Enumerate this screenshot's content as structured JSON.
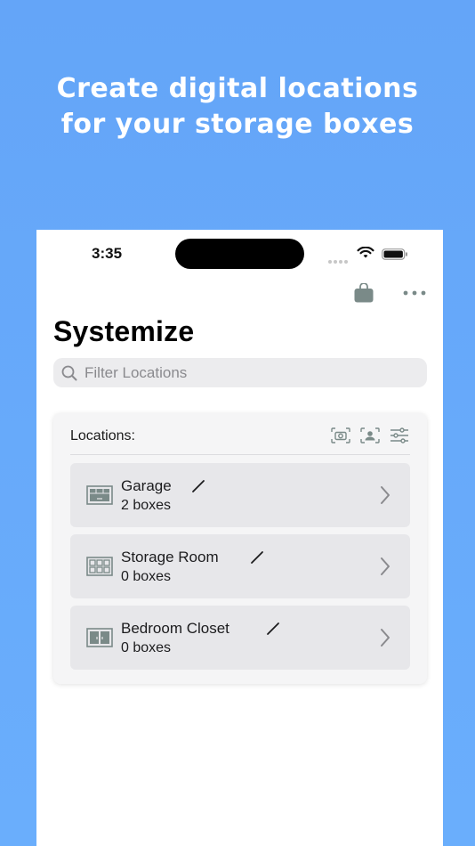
{
  "promo": {
    "line1": "Create digital locations",
    "line2": "for your storage boxes"
  },
  "status_bar": {
    "time": "3:35"
  },
  "app": {
    "title": "Systemize"
  },
  "search": {
    "placeholder": "Filter Locations",
    "value": ""
  },
  "locations_card": {
    "title": "Locations:",
    "tool_icons": [
      "camera-icon",
      "person-scan-icon",
      "sliders-icon"
    ],
    "items": [
      {
        "name": "Garage",
        "count": "2 boxes",
        "icon": "garage-icon"
      },
      {
        "name": "Storage Room",
        "count": "0 boxes",
        "icon": "shelves-icon"
      },
      {
        "name": "Bedroom Closet",
        "count": "0 boxes",
        "icon": "closet-icon"
      }
    ]
  },
  "colors": {
    "background": "#64a5f8",
    "row_background": "#e7e7ea",
    "icon_gray": "#7a8a88"
  }
}
